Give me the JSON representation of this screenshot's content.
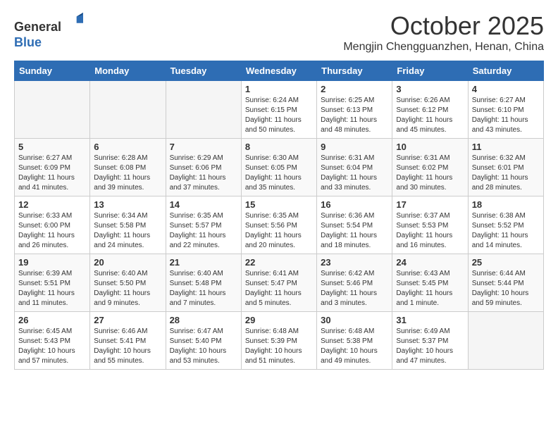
{
  "header": {
    "logo": {
      "line1": "General",
      "line2": "Blue"
    },
    "title": "October 2025",
    "location": "Mengjin Chengguanzhen, Henan, China"
  },
  "weekdays": [
    "Sunday",
    "Monday",
    "Tuesday",
    "Wednesday",
    "Thursday",
    "Friday",
    "Saturday"
  ],
  "weeks": [
    [
      {
        "day": "",
        "empty": true
      },
      {
        "day": "",
        "empty": true
      },
      {
        "day": "",
        "empty": true
      },
      {
        "day": "1",
        "sunrise": "6:24 AM",
        "sunset": "6:15 PM",
        "daylight": "11 hours and 50 minutes."
      },
      {
        "day": "2",
        "sunrise": "6:25 AM",
        "sunset": "6:13 PM",
        "daylight": "11 hours and 48 minutes."
      },
      {
        "day": "3",
        "sunrise": "6:26 AM",
        "sunset": "6:12 PM",
        "daylight": "11 hours and 45 minutes."
      },
      {
        "day": "4",
        "sunrise": "6:27 AM",
        "sunset": "6:10 PM",
        "daylight": "11 hours and 43 minutes."
      }
    ],
    [
      {
        "day": "5",
        "sunrise": "6:27 AM",
        "sunset": "6:09 PM",
        "daylight": "11 hours and 41 minutes."
      },
      {
        "day": "6",
        "sunrise": "6:28 AM",
        "sunset": "6:08 PM",
        "daylight": "11 hours and 39 minutes."
      },
      {
        "day": "7",
        "sunrise": "6:29 AM",
        "sunset": "6:06 PM",
        "daylight": "11 hours and 37 minutes."
      },
      {
        "day": "8",
        "sunrise": "6:30 AM",
        "sunset": "6:05 PM",
        "daylight": "11 hours and 35 minutes."
      },
      {
        "day": "9",
        "sunrise": "6:31 AM",
        "sunset": "6:04 PM",
        "daylight": "11 hours and 33 minutes."
      },
      {
        "day": "10",
        "sunrise": "6:31 AM",
        "sunset": "6:02 PM",
        "daylight": "11 hours and 30 minutes."
      },
      {
        "day": "11",
        "sunrise": "6:32 AM",
        "sunset": "6:01 PM",
        "daylight": "11 hours and 28 minutes."
      }
    ],
    [
      {
        "day": "12",
        "sunrise": "6:33 AM",
        "sunset": "6:00 PM",
        "daylight": "11 hours and 26 minutes."
      },
      {
        "day": "13",
        "sunrise": "6:34 AM",
        "sunset": "5:58 PM",
        "daylight": "11 hours and 24 minutes."
      },
      {
        "day": "14",
        "sunrise": "6:35 AM",
        "sunset": "5:57 PM",
        "daylight": "11 hours and 22 minutes."
      },
      {
        "day": "15",
        "sunrise": "6:35 AM",
        "sunset": "5:56 PM",
        "daylight": "11 hours and 20 minutes."
      },
      {
        "day": "16",
        "sunrise": "6:36 AM",
        "sunset": "5:54 PM",
        "daylight": "11 hours and 18 minutes."
      },
      {
        "day": "17",
        "sunrise": "6:37 AM",
        "sunset": "5:53 PM",
        "daylight": "11 hours and 16 minutes."
      },
      {
        "day": "18",
        "sunrise": "6:38 AM",
        "sunset": "5:52 PM",
        "daylight": "11 hours and 14 minutes."
      }
    ],
    [
      {
        "day": "19",
        "sunrise": "6:39 AM",
        "sunset": "5:51 PM",
        "daylight": "11 hours and 11 minutes."
      },
      {
        "day": "20",
        "sunrise": "6:40 AM",
        "sunset": "5:50 PM",
        "daylight": "11 hours and 9 minutes."
      },
      {
        "day": "21",
        "sunrise": "6:40 AM",
        "sunset": "5:48 PM",
        "daylight": "11 hours and 7 minutes."
      },
      {
        "day": "22",
        "sunrise": "6:41 AM",
        "sunset": "5:47 PM",
        "daylight": "11 hours and 5 minutes."
      },
      {
        "day": "23",
        "sunrise": "6:42 AM",
        "sunset": "5:46 PM",
        "daylight": "11 hours and 3 minutes."
      },
      {
        "day": "24",
        "sunrise": "6:43 AM",
        "sunset": "5:45 PM",
        "daylight": "11 hours and 1 minute."
      },
      {
        "day": "25",
        "sunrise": "6:44 AM",
        "sunset": "5:44 PM",
        "daylight": "10 hours and 59 minutes."
      }
    ],
    [
      {
        "day": "26",
        "sunrise": "6:45 AM",
        "sunset": "5:43 PM",
        "daylight": "10 hours and 57 minutes."
      },
      {
        "day": "27",
        "sunrise": "6:46 AM",
        "sunset": "5:41 PM",
        "daylight": "10 hours and 55 minutes."
      },
      {
        "day": "28",
        "sunrise": "6:47 AM",
        "sunset": "5:40 PM",
        "daylight": "10 hours and 53 minutes."
      },
      {
        "day": "29",
        "sunrise": "6:48 AM",
        "sunset": "5:39 PM",
        "daylight": "10 hours and 51 minutes."
      },
      {
        "day": "30",
        "sunrise": "6:48 AM",
        "sunset": "5:38 PM",
        "daylight": "10 hours and 49 minutes."
      },
      {
        "day": "31",
        "sunrise": "6:49 AM",
        "sunset": "5:37 PM",
        "daylight": "10 hours and 47 minutes."
      },
      {
        "day": "",
        "empty": true
      }
    ]
  ]
}
